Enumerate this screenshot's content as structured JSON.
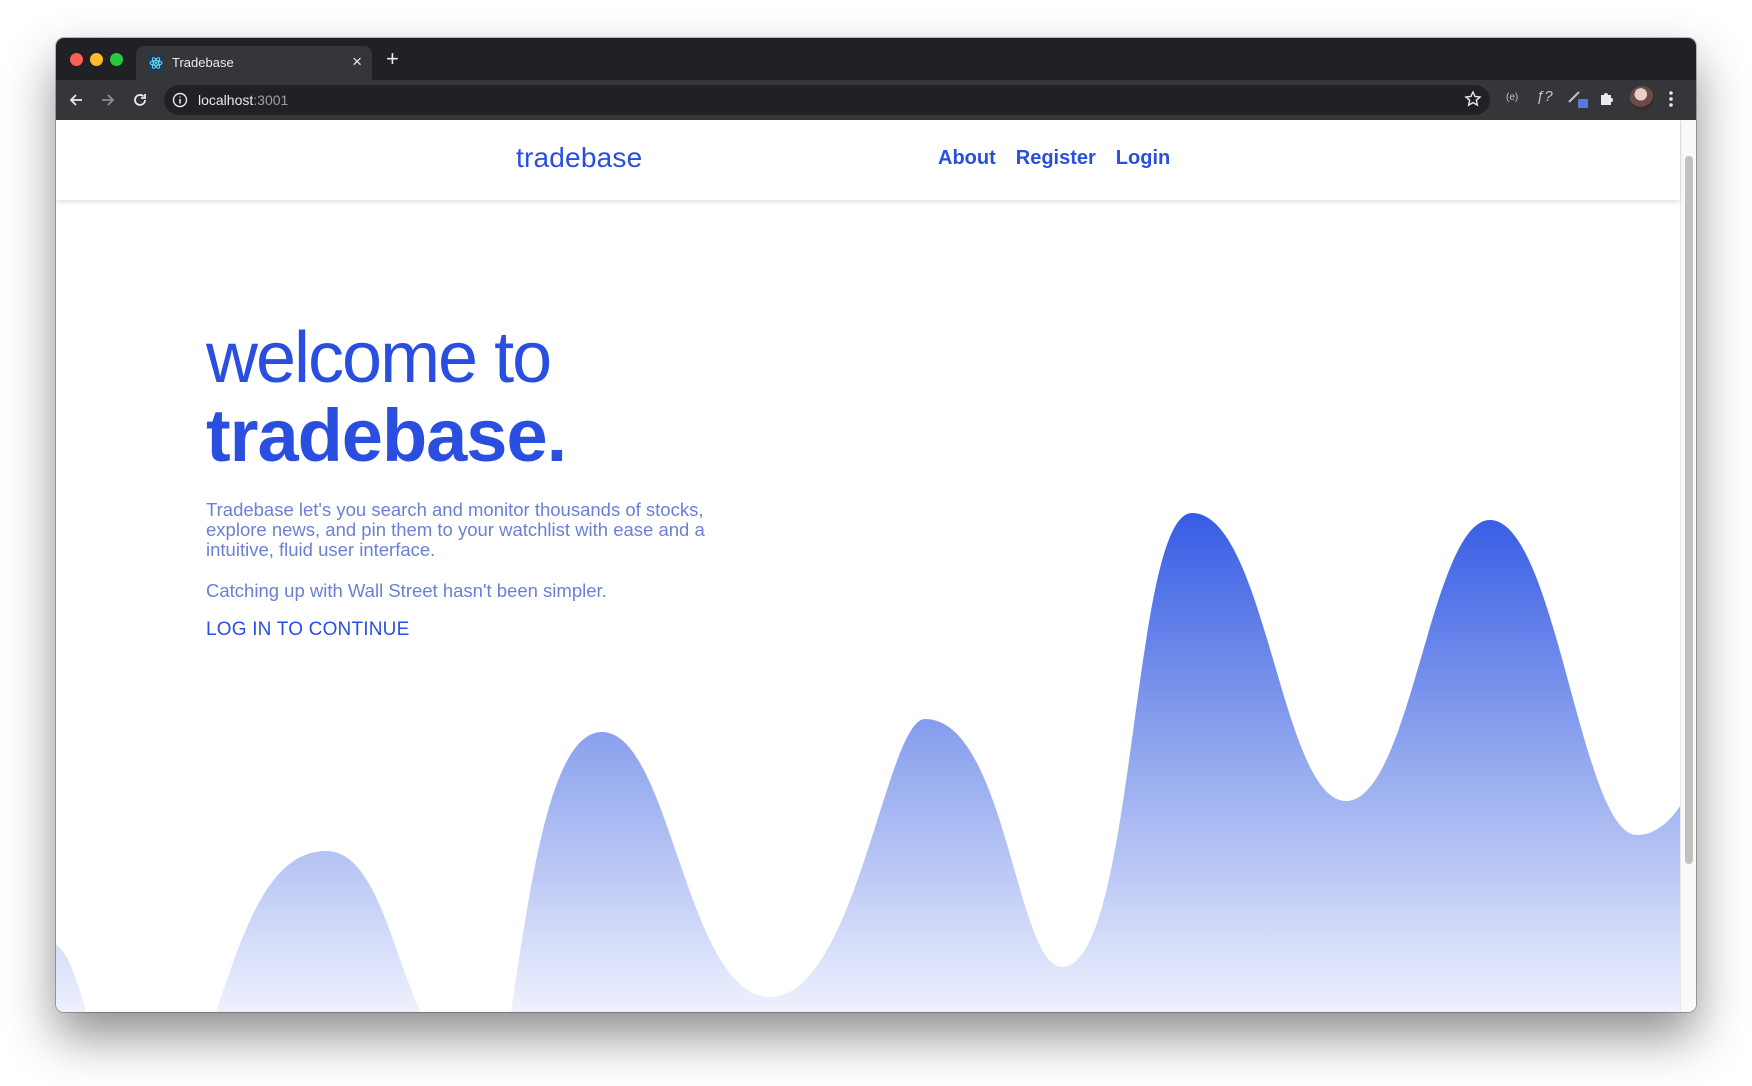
{
  "browser": {
    "tab_title": "Tradebase",
    "new_tab": "+",
    "close_tab": "×",
    "url_host": "localhost",
    "url_port": ":3001",
    "extensions": [
      "(e)",
      "ƒ?"
    ]
  },
  "header": {
    "brand": "tradebase",
    "nav": [
      {
        "label": "About"
      },
      {
        "label": "Register"
      },
      {
        "label": "Login"
      }
    ]
  },
  "hero": {
    "line1": "welcome to",
    "line2": "tradebase.",
    "description": "Tradebase let's you search and monitor thousands of stocks, explore news, and pin them to your watchlist with ease and a intuitive, fluid user interface.",
    "tagline": "Catching up with Wall Street hasn't been simpler.",
    "cta": "LOG IN TO CONTINUE"
  },
  "colors": {
    "brand_blue": "#2a4ee0",
    "text_soft_blue": "#6a80d6",
    "chrome_dark": "#202124"
  }
}
